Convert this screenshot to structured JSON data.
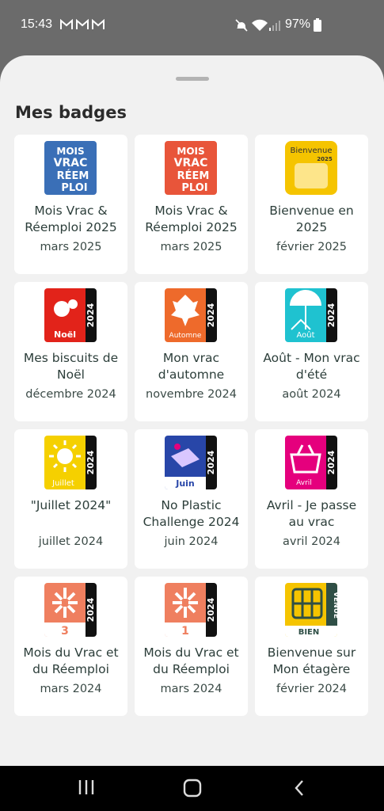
{
  "status_bar": {
    "time": "15:43",
    "notification_icons": [
      "gmail-icon",
      "gmail-icon",
      "gmail-icon"
    ],
    "battery": "97%"
  },
  "sheet": {
    "title": "Mes badges"
  },
  "badges": [
    {
      "name": "Mois Vrac & Réemploi 2025",
      "date": "mars 2025",
      "icon": "mois-vrac-reemploi-blue-badge",
      "color": "#3a6fb7",
      "text": "MOIS VRAC RÉEM PLOI"
    },
    {
      "name": "Mois Vrac & Réemploi 2025",
      "date": "mars 2025",
      "icon": "mois-vrac-reemploi-orange-badge",
      "color": "#e8553a",
      "text": "MOIS VRAC RÉEM PLOI"
    },
    {
      "name": "Bienvenue en 2025",
      "date": "février 2025",
      "icon": "bienvenue-2025-badge",
      "color": "#f5c400",
      "text": "Bienvenue 2025"
    },
    {
      "name": "Mes biscuits de Noël",
      "date": "décembre 2024",
      "icon": "noel-2024-badge",
      "color": "#e2231a",
      "text": "Noël"
    },
    {
      "name": "Mon vrac d'automne",
      "date": "novembre 2024",
      "icon": "automne-2024-badge",
      "color": "#ee6a2b",
      "text": "Automne"
    },
    {
      "name": "Août - Mon vrac d'été",
      "date": "août 2024",
      "icon": "aout-2024-badge",
      "color": "#1fc2d0",
      "text": "Août"
    },
    {
      "name": "\"Juillet 2024\"",
      "date": "juillet 2024",
      "icon": "juillet-2024-badge",
      "color": "#f5d000",
      "text": "Juillet"
    },
    {
      "name": "No Plastic Challenge 2024",
      "date": "juin 2024",
      "icon": "juin-2024-badge",
      "color": "#2846a8",
      "text": "Juin"
    },
    {
      "name": "Avril - Je passe au vrac",
      "date": "avril 2024",
      "icon": "avril-2024-badge",
      "color": "#e5007d",
      "text": "Avril"
    },
    {
      "name": "Mois du Vrac et du Réemploi",
      "date": "mars 2024",
      "icon": "mois-vrac-3-badge",
      "color": "#ef7f5f",
      "text": "3"
    },
    {
      "name": "Mois du Vrac et du Réemploi",
      "date": "mars 2024",
      "icon": "mois-vrac-1-badge",
      "color": "#ef7f5f",
      "text": "1"
    },
    {
      "name": "Bienvenue sur Mon étagère",
      "date": "février 2024",
      "icon": "bienvenue-etagere-badge",
      "color": "#f5c400",
      "text": "BIEN VENUE"
    }
  ],
  "badge_year_strip": "2024",
  "nav_bar": {
    "buttons": [
      "recent-apps-icon",
      "home-icon",
      "back-icon"
    ]
  }
}
